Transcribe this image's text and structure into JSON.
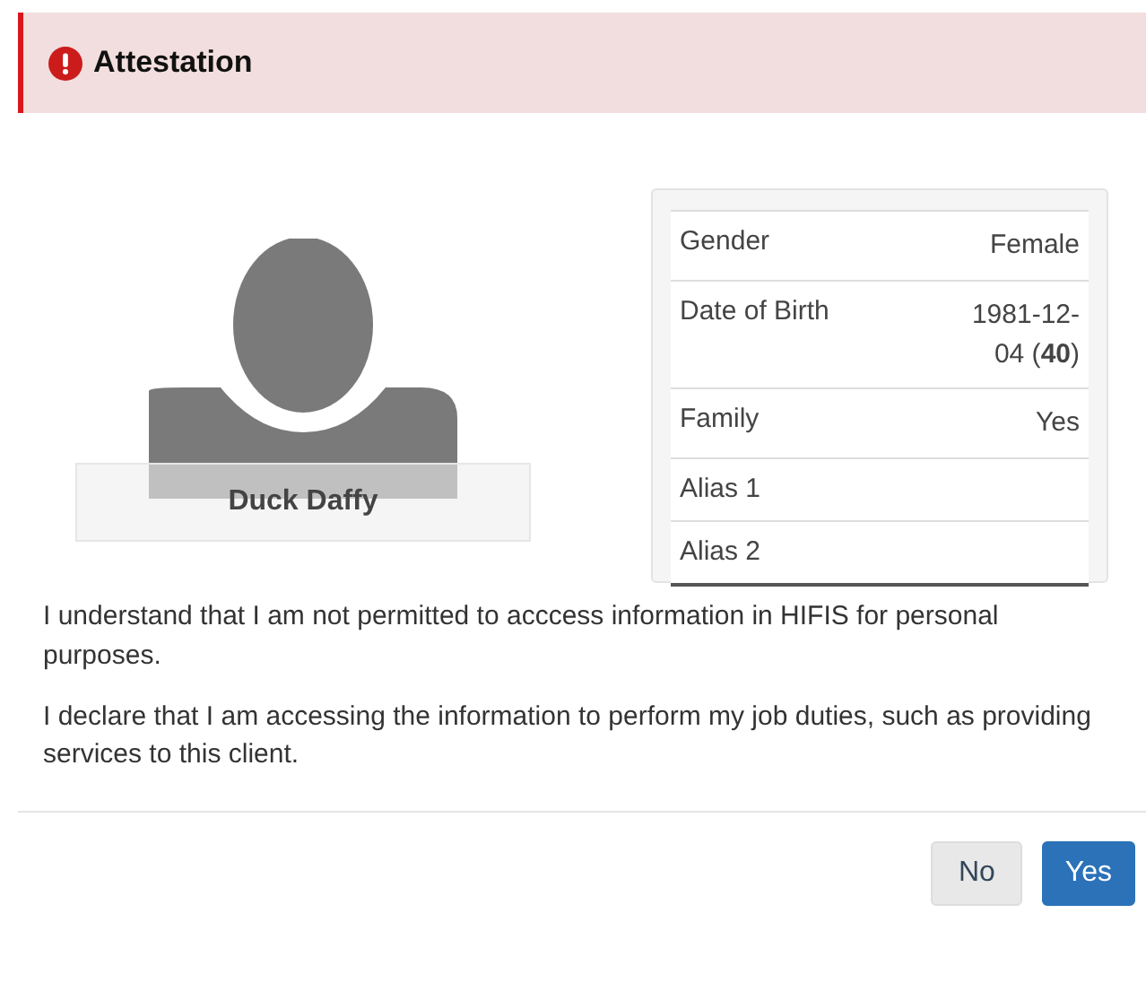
{
  "header": {
    "title": "Attestation"
  },
  "client": {
    "name": "Duck Daffy"
  },
  "details": [
    {
      "label": "Gender",
      "value": "Female"
    },
    {
      "label": "Date of Birth",
      "value": "1981-12-04 (**40**)"
    },
    {
      "label": "Family",
      "value": "Yes"
    },
    {
      "label": "Alias 1"
    },
    {
      "label": "Alias 2"
    }
  ],
  "paragraphs": [
    "I understand that I am not permitted to acccess information in HIFIS for personal purposes.",
    "I declare that I am accessing the information to perform my job duties, such as providing services to this client."
  ],
  "buttons": [
    {
      "label": "No",
      "kind": "default"
    },
    {
      "label": "Yes",
      "kind": "primary"
    }
  ]
}
